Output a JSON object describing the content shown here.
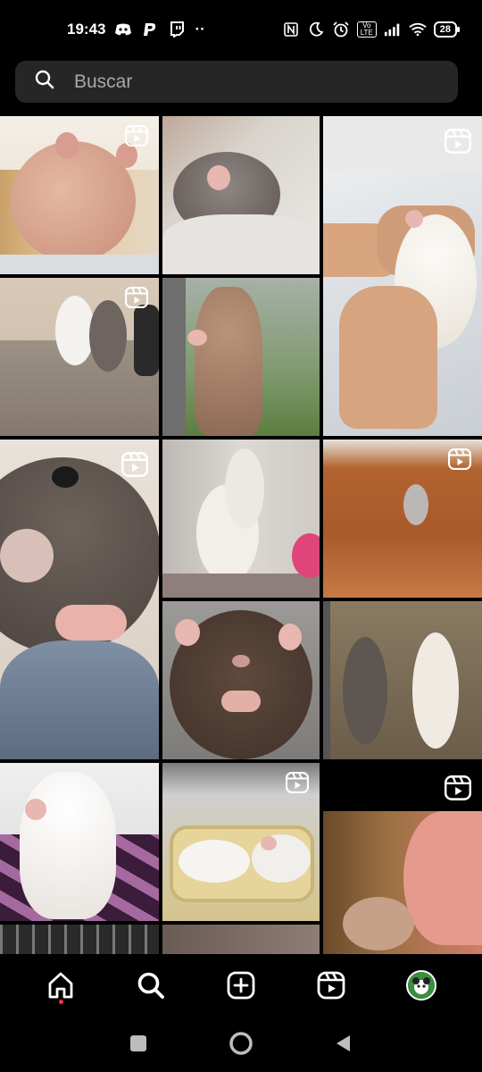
{
  "status_bar": {
    "time": "19:43",
    "battery": "28",
    "volte": "Vo LTE",
    "more_indicator": "··"
  },
  "search": {
    "placeholder": "Buscar"
  },
  "grid": {
    "tiles": [
      {
        "name": "tile-hairless-rat",
        "reel": true
      },
      {
        "name": "tile-gray-rat-blanket",
        "reel": false
      },
      {
        "name": "tile-white-rat-hand",
        "reel": true
      },
      {
        "name": "tile-two-rats-bed",
        "reel": true
      },
      {
        "name": "tile-rat-window",
        "reel": false
      },
      {
        "name": "tile-rat-closeup",
        "reel": true
      },
      {
        "name": "tile-white-rats-corner",
        "reel": false
      },
      {
        "name": "tile-rat-wood-floor",
        "reel": true
      },
      {
        "name": "tile-brown-rat-front",
        "reel": false
      },
      {
        "name": "tile-two-rats-cage",
        "reel": false
      },
      {
        "name": "tile-white-rat-bed",
        "reel": false
      },
      {
        "name": "tile-rats-basket",
        "reel": true
      },
      {
        "name": "tile-rat-face-closeup",
        "reel": true
      },
      {
        "name": "tile-rat-partial-1",
        "reel": false
      },
      {
        "name": "tile-rat-partial-2",
        "reel": false
      }
    ]
  },
  "bottom_nav": {
    "items": [
      {
        "name": "home",
        "icon": "home-icon",
        "active": true
      },
      {
        "name": "search",
        "icon": "search-icon",
        "active": false
      },
      {
        "name": "create",
        "icon": "add-post-icon",
        "active": false
      },
      {
        "name": "reels",
        "icon": "reels-icon",
        "active": false
      },
      {
        "name": "profile",
        "icon": "profile-avatar",
        "active": false
      }
    ]
  },
  "system_nav": {
    "items": [
      "recents-button",
      "home-button",
      "back-button"
    ]
  },
  "colors": {
    "background": "#000000",
    "search_bg": "#262626",
    "placeholder": "#a8a8a8",
    "notification_dot": "#ff3040"
  }
}
